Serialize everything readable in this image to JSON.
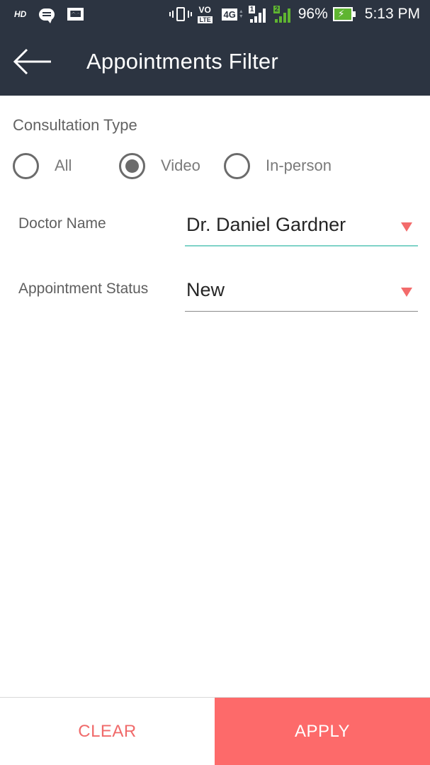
{
  "status_bar": {
    "hd_label": "HD",
    "vo_label": "VO",
    "lte_label": "LTE",
    "network_label": "4G",
    "sim1_label": "1",
    "sim2_label": "2",
    "battery_percent": "96%",
    "time": "5:13 PM",
    "icons": [
      "hd-icon",
      "message-icon",
      "image-icon",
      "vibrate-icon",
      "volte-icon",
      "4g-icon",
      "sim1-signal-icon",
      "sim2-signal-icon",
      "battery-charging-icon"
    ]
  },
  "app_bar": {
    "back_icon": "arrow-left-icon",
    "title": "Appointments Filter"
  },
  "consultation_type": {
    "label": "Consultation Type",
    "options": [
      {
        "label": "All",
        "checked": false
      },
      {
        "label": "Video",
        "checked": true
      },
      {
        "label": "In-person",
        "checked": false
      }
    ]
  },
  "doctor_name": {
    "label": "Doctor Name",
    "value": "Dr. Daniel Gardner",
    "focused": true
  },
  "appointment_status": {
    "label": "Appointment Status",
    "value": "New",
    "focused": false
  },
  "actions": {
    "clear_label": "CLEAR",
    "apply_label": "APPLY"
  },
  "colors": {
    "header_bg": "#2c3441",
    "accent": "#fd6a6a",
    "caret": "#f36b6b",
    "focused_underline": "#7fd3c8",
    "underline": "#8a8a8a",
    "sim2_green": "#5fb531"
  }
}
